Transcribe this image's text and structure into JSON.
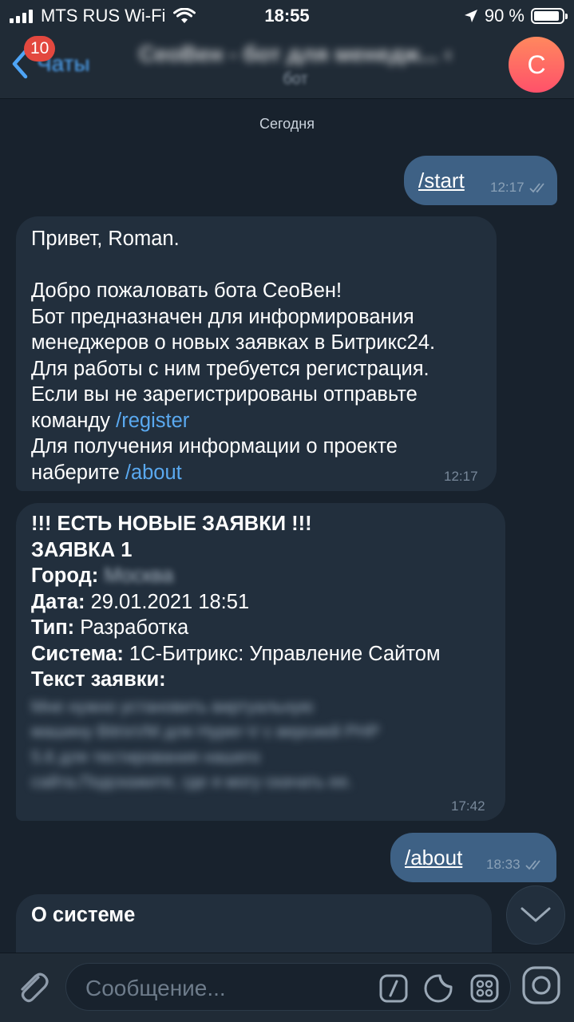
{
  "status_bar": {
    "carrier": "MTS RUS Wi-Fi",
    "time": "18:55",
    "battery": "90 %",
    "battery_level": 0.9
  },
  "header": {
    "back_label": "Чаты",
    "unread_count": "10",
    "title": "СеоВен - бот для менедж... ‹",
    "subtitle": "бот",
    "avatar_letter": "C",
    "accent": "#4ea4f5",
    "badge_color": "#e3483f"
  },
  "chat": {
    "date_separator": "Сегодня",
    "messages": [
      {
        "direction": "out",
        "text": "/start",
        "time": "12:17"
      },
      {
        "direction": "in",
        "greeting": "Привет, Roman.",
        "lines": [
          "Добро пожаловать бота СеоВен!",
          "Бот предназначен для информирования",
          "менеджеров о новых заявках в Битрикс24.",
          "Для работы с ним требуется регистрация.",
          "Если вы не зарегистрированы отправьте",
          "команду",
          "/register",
          "Для получения информации о проекте",
          "наберите",
          "/about"
        ],
        "time": "12:17"
      },
      {
        "direction": "in",
        "heading": "!!! ЕСТЬ НОВЫЕ ЗАЯВКИ !!!",
        "subheading": "ЗАЯВКА 1",
        "fields": [
          {
            "label": "Город:",
            "value": "Москва"
          },
          {
            "label": "Дата:",
            "value": "29.01.2021 18:51"
          },
          {
            "label": "Тип:",
            "value": "Разработка"
          },
          {
            "label": "Система:",
            "value": "1С-Битрикс: Управление Сайтом"
          },
          {
            "label": "Текст заявки:",
            "value": ""
          }
        ],
        "body_lines": [
          "Мне нужно установить виртуальную",
          "машину BitrixVM для Hyper-V с версией PHP",
          "5.6 для тестирования нашего",
          "сайта.Подскажите, где я могу скачать ее."
        ],
        "time": "17:42"
      },
      {
        "direction": "out",
        "text": "/about",
        "time": "18:33"
      },
      {
        "direction": "in",
        "heading": "О системе"
      }
    ]
  },
  "input": {
    "placeholder": "Сообщение..."
  },
  "icons": {
    "attach": "paperclip-icon",
    "commands": "slash-icon",
    "sticker": "sticker-icon",
    "emoji": "apps-icon",
    "voice": "camera-circle-icon",
    "scroll": "chevron-down-icon"
  }
}
